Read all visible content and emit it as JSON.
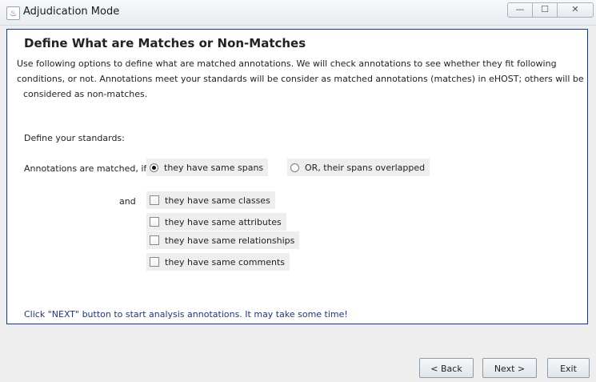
{
  "window": {
    "title": "Adjudication Mode",
    "minimize_glyph": "—",
    "maximize_glyph": "☐",
    "close_glyph": "✕"
  },
  "panel": {
    "heading": "Define What are Matches or Non-Matches",
    "description": [
      "Use following options to define what are matched annotations. We will check annotations to see whether they fit following",
      "conditions, or not. Annotations meet your standards will be consider as matched annotations (matches) in eHOST; others will be",
      "considered as non-matches."
    ],
    "standards_label": "Define your standards:",
    "matched_if_label": "Annotations are matched, if",
    "radio_same_spans": "they have same spans",
    "radio_overlapped": "OR, their spans overlapped",
    "and_label": "and",
    "check_classes": "they have same classes",
    "check_attributes": "they have same attributes",
    "check_relationships": "they have same relationships",
    "check_comments": "they have same comments",
    "footer_note": "Click \"NEXT\" button to start analysis annotations. It may take some time!"
  },
  "state": {
    "selected_span_option": "they have same spans",
    "classes_checked": false,
    "attributes_checked": false,
    "relationships_checked": false,
    "comments_checked": false
  },
  "buttons": {
    "back": "< Back",
    "next": "Next >",
    "exit": "Exit"
  }
}
